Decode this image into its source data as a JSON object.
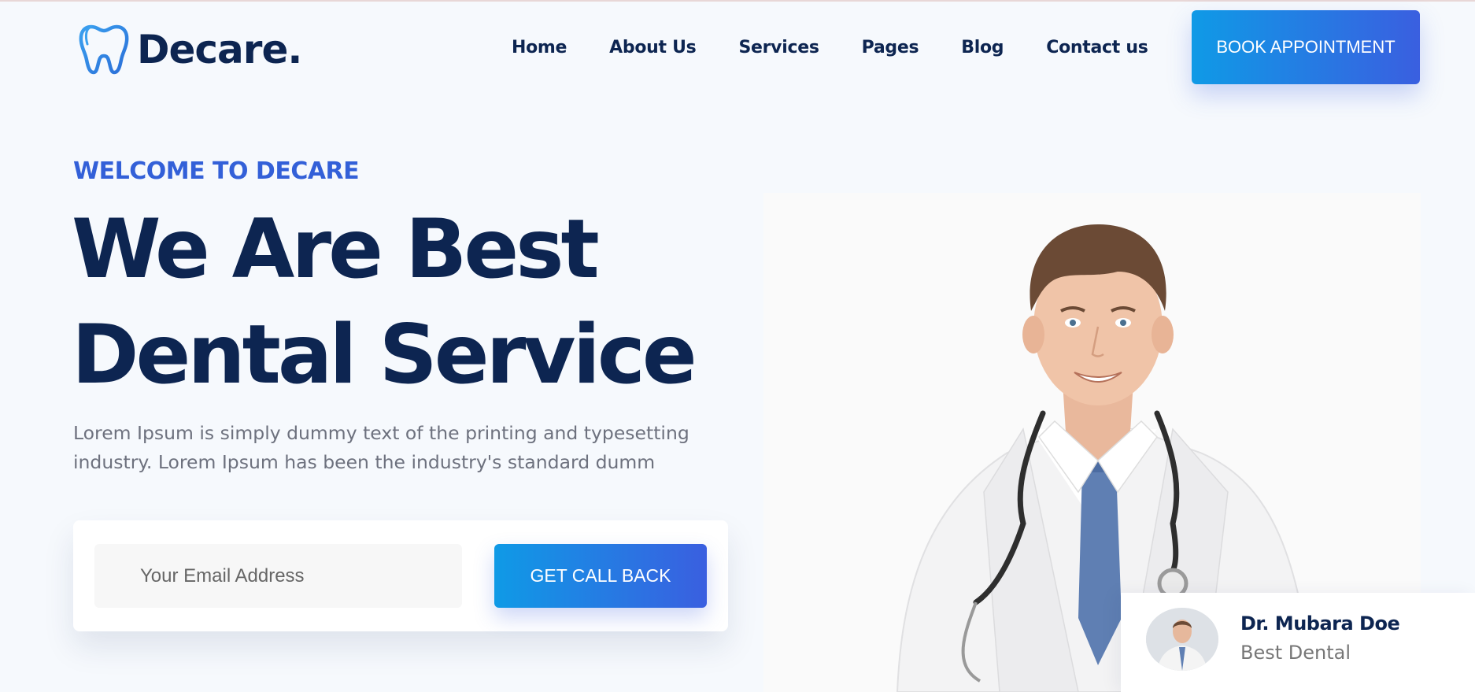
{
  "brand": {
    "name": "Decare.",
    "primary_color": "#0d2551",
    "accent_color": "#3360d8",
    "gradient": [
      "#0f9ae6",
      "#3a5fe0"
    ]
  },
  "nav": {
    "items": [
      "Home",
      "About Us",
      "Services",
      "Pages",
      "Blog",
      "Contact us"
    ],
    "cta_label": "BOOK APPOINTMENT"
  },
  "hero": {
    "eyebrow": "WELCOME TO DECARE",
    "title_line1": "We Are Best",
    "title_line2": "Dental Service",
    "description": "Lorem Ipsum is simply dummy text of the printing and typesetting industry. Lorem Ipsum has been the industry's standard dumm"
  },
  "form": {
    "email_placeholder": "Your Email Address",
    "submit_label": "GET CALL BACK"
  },
  "doctor": {
    "name": "Dr. Mubara Doe",
    "role": "Best Dental"
  }
}
